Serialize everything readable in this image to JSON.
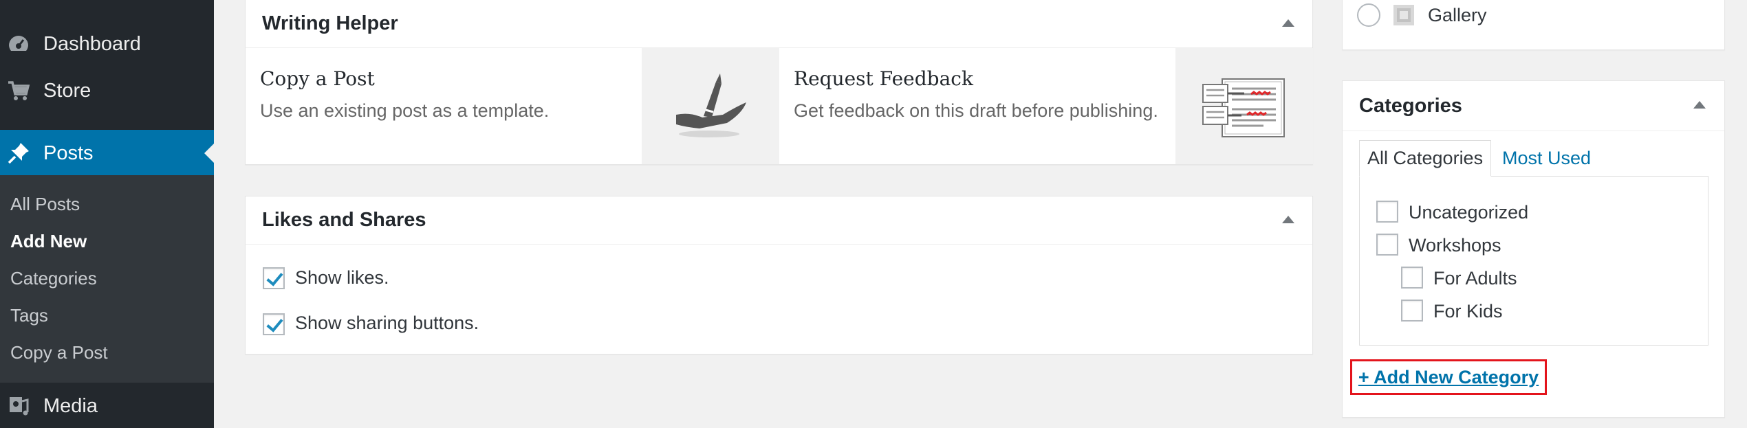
{
  "sidebar": {
    "items": [
      {
        "label": "Dashboard",
        "icon": "dashboard-icon"
      },
      {
        "label": "Store",
        "icon": "cart-icon"
      },
      {
        "label": "Posts",
        "icon": "pushpin-icon"
      },
      {
        "label": "Media",
        "icon": "media-icon"
      }
    ],
    "submenu": [
      "All Posts",
      "Add New",
      "Categories",
      "Tags",
      "Copy a Post"
    ]
  },
  "format_box": {
    "gallery_label": "Gallery"
  },
  "writing_helper": {
    "title": "Writing Helper",
    "copy_post": {
      "title": "Copy a Post",
      "desc": "Use an existing post as a template."
    },
    "request_feedback": {
      "title": "Request Feedback",
      "desc": "Get feedback on this draft before publishing."
    }
  },
  "likes_shares": {
    "title": "Likes and Shares",
    "show_likes": "Show likes.",
    "show_sharing": "Show sharing buttons."
  },
  "categories": {
    "title": "Categories",
    "tab_all": "All Categories",
    "tab_most_used": "Most Used",
    "items": [
      "Uncategorized",
      "Workshops",
      "For Adults",
      "For Kids"
    ],
    "add_new": "+ Add New Category"
  },
  "colors": {
    "accent": "#0073aa",
    "sidebar_bg": "#23282d",
    "highlight_border": "#e3141c"
  }
}
